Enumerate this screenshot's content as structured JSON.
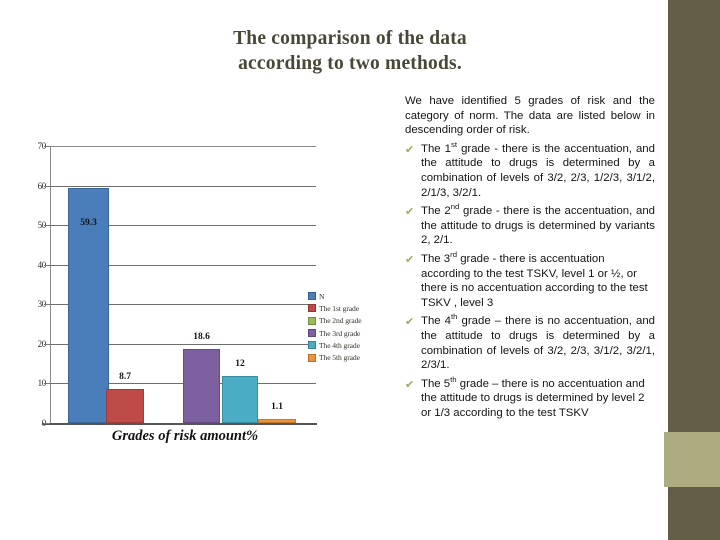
{
  "slide": {
    "title_line1": "The comparison of the data",
    "title_line2": "according to two methods.",
    "title_color": "#494735",
    "deco_color_dark": "#635E48",
    "deco_color_light": "#ADAC80"
  },
  "chart_data": {
    "type": "bar",
    "title": "",
    "xlabel": "Grades of risk amount%",
    "ylabel": "",
    "categories": [
      "N",
      "The 1st grade",
      "The 2nd grade",
      "The 3rd grade",
      "The 4th grade",
      "The 5th grade"
    ],
    "values": [
      59.3,
      8.7,
      18.6,
      12,
      1.1
    ],
    "value_labels": [
      "59.3",
      "8.7",
      "18.6",
      "12",
      "1.1"
    ],
    "bar_categories": [
      "N",
      "The 1st grade",
      "The 3rd grade",
      "The 4th grade",
      "The 5th grade"
    ],
    "bar_colors": [
      "#4A7EBB",
      "#BE4B48",
      "#7D60A0",
      "#4BACC6",
      "#F0943B"
    ],
    "ylim": [
      0,
      70
    ],
    "yticks": [
      "0",
      "10",
      "20",
      "30",
      "40",
      "50",
      "60",
      "70"
    ],
    "grid": true,
    "legend_position": "right",
    "legend": [
      {
        "label": "N",
        "color": "#4A7EBB"
      },
      {
        "label": "The 1st grade",
        "color": "#BE4B48"
      },
      {
        "label": "The 2nd grade",
        "color": "#9BBB59"
      },
      {
        "label": "The 3rd grade",
        "color": "#7D60A0"
      },
      {
        "label": "The 4th grade",
        "color": "#4BACC6"
      },
      {
        "label": "The 5th grade",
        "color": "#F0943B"
      }
    ]
  },
  "text_panel": {
    "intro": "We have identified 5 grades of risk and the category of norm. The data are listed below in descending order of risk.",
    "bullet_marker": "✔",
    "bullets": [
      {
        "prefix": "The 1",
        "sup": "st",
        "rest": " grade - there is the accentuation, and the attitude to drugs is determined by a combination of levels of 3/2, 2/3, 1/2/3, 3/1/2, 2/1/3, 3/2/1."
      },
      {
        "prefix": "The 2",
        "sup": "nd",
        "rest": " grade - there is the accentuation, and the attitude to drugs is determined by variants 2, 2/1."
      },
      {
        "prefix": "The 3",
        "sup": "rd",
        "rest": " grade - there is accentuation according to the test TSKV, level 1 or ½, or there is no accentuation according to the test TSKV , level 3"
      },
      {
        "prefix": "The 4",
        "sup": "th",
        "rest": " grade – there is no accentuation, and the attitude to drugs is determined by a combination of levels of 3/2, 2/3, 3/1/2, 3/2/1, 2/3/1."
      },
      {
        "prefix": "The 5",
        "sup": "th",
        "rest": " grade – there is no accentuation and the attitude to drugs is determined by level 2 or 1/3 according to the test TSKV"
      }
    ]
  }
}
